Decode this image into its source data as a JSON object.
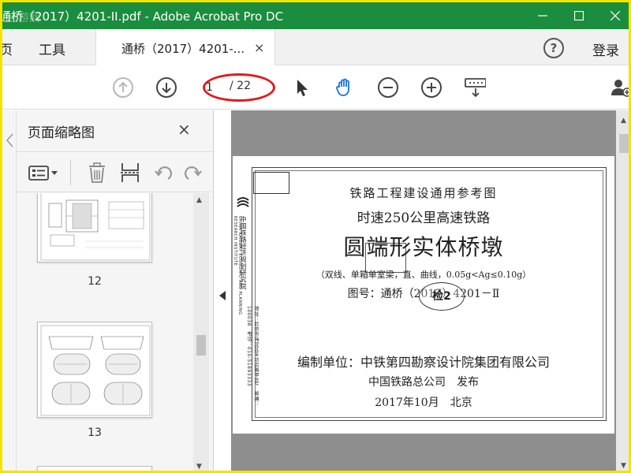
{
  "titlebar": {
    "title": "通桥（2017）4201-II.pdf - Adobe Acrobat Pro DC",
    "watermark": "迁游网"
  },
  "tabbar": {
    "menu_fragment": "页",
    "tools": "工具",
    "doc_tab_label": "通桥（2017）4201-...",
    "close_glyph": "×",
    "help_glyph": "?",
    "login": "登录"
  },
  "toolbar": {
    "current_page": "1",
    "page_total": "/ 22"
  },
  "panel": {
    "title": "页面缩略图",
    "close_glyph": "×",
    "thumb_labels": [
      "12",
      "13"
    ]
  },
  "page_content": {
    "header": "铁路工程建设通用参考图",
    "subtitle": "时速250公里高速铁路",
    "main_title": "圆端形实体桥墩",
    "spec": "（双线、单箱单室梁，直、曲线，0.05g<Ag≤0.10g）",
    "drawing_no": "图号：通桥（2017）4201－Ⅱ",
    "stamp": "检2",
    "compiler": "编制单位：中铁第四勘察设计院集团有限公司",
    "issuer": "中国铁路总公司　发布",
    "date": "2017年10月　北京",
    "side_institute": "中国铁路经济规划研究院",
    "side_institute_en": "CHINA RAILWAY ECONOMIC AND PLANNING RESEARCH INSTITUTE",
    "side_info": "地址：北京市海淀区羊坊店路甲8号　邮编：100038　电话：010-51893333"
  },
  "colors": {
    "titlebar": "#1b8d3e",
    "highlight_ellipse": "#e3191a",
    "frame_border": "#f2e400",
    "hand_tool": "#1473e6"
  }
}
